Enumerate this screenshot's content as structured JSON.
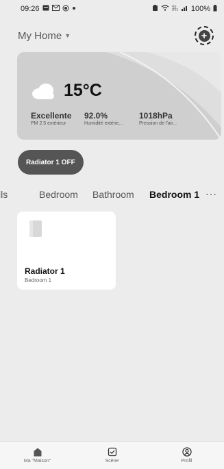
{
  "statusbar": {
    "time": "09:26",
    "left_icons": [
      "calendar-icon",
      "mail-icon",
      "record-icon",
      "dot-icon"
    ],
    "right_icons": [
      "battery-saver-icon",
      "wifi-icon",
      "volte-icon",
      "signal-icon"
    ],
    "battery": "100%"
  },
  "header": {
    "home_name": "My Home",
    "caret_icon": "caret-down-icon",
    "add_icon": "add-circle-icon"
  },
  "weather": {
    "temperature": "15°C",
    "icon": "cloud-icon",
    "metrics": [
      {
        "value": "Excellente",
        "label": "PM 2.5 extérieur"
      },
      {
        "value": "92.0%",
        "label": "Humidité extérie..."
      },
      {
        "value": "1018hPa",
        "label": "Pression de l'air..."
      }
    ]
  },
  "scene_chip": {
    "label": "Radiator 1 OFF"
  },
  "tabs": {
    "items": [
      {
        "label": "ils",
        "active": false
      },
      {
        "label": "Bedroom",
        "active": false
      },
      {
        "label": "Bathroom",
        "active": false
      },
      {
        "label": "Bedroom 1",
        "active": true
      }
    ],
    "more": "···"
  },
  "device": {
    "name": "Radiator 1",
    "room": "Bedroom 1",
    "icon": "radiator-icon"
  },
  "bottom_nav": {
    "items": [
      {
        "label": "Ma \"Maison\"",
        "icon": "home-icon"
      },
      {
        "label": "Scène",
        "icon": "scene-check-icon"
      },
      {
        "label": "Profil",
        "icon": "profile-icon"
      }
    ]
  }
}
